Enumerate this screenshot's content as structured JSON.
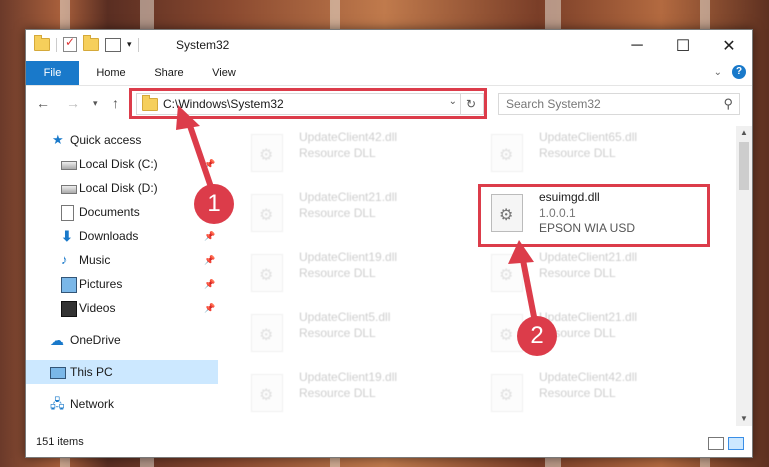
{
  "window": {
    "title": "System32",
    "icons": [
      "folder-icon",
      "properties-icon",
      "new-folder-icon",
      "view-icon"
    ]
  },
  "ribbon": {
    "tabs": [
      "File",
      "Home",
      "Share",
      "View"
    ],
    "help": "?"
  },
  "address": {
    "path": "C:\\Windows\\System32",
    "search_placeholder": "Search System32"
  },
  "nav": {
    "items": [
      {
        "label": "Quick access",
        "icon": "star-icon",
        "pinned": false
      },
      {
        "label": "Local Disk (C:)",
        "icon": "disk-icon",
        "pinned": true
      },
      {
        "label": "Local Disk (D:)",
        "icon": "disk-icon",
        "pinned": true
      },
      {
        "label": "Documents",
        "icon": "documents-icon",
        "pinned": true
      },
      {
        "label": "Downloads",
        "icon": "downloads-icon",
        "pinned": true
      },
      {
        "label": "Music",
        "icon": "music-icon",
        "pinned": true
      },
      {
        "label": "Pictures",
        "icon": "pictures-icon",
        "pinned": true
      },
      {
        "label": "Videos",
        "icon": "videos-icon",
        "pinned": true
      },
      {
        "label": "OneDrive",
        "icon": "cloud-icon",
        "pinned": false
      },
      {
        "label": "This PC",
        "icon": "pc-icon",
        "pinned": false,
        "selected": true
      },
      {
        "label": "Network",
        "icon": "network-icon",
        "pinned": false
      }
    ]
  },
  "files": {
    "col1": [
      {
        "name": "UpdateClient42.dll",
        "type": "Resource DLL"
      },
      {
        "name": "UpdateClient21.dll",
        "type": "Resource DLL"
      },
      {
        "name": "UpdateClient19.dll",
        "type": "Resource DLL"
      },
      {
        "name": "UpdateClient5.dll",
        "type": "Resource DLL"
      },
      {
        "name": "UpdateClient19.dll",
        "type": "Resource DLL"
      }
    ],
    "col2": [
      {
        "name": "UpdateClient65.dll",
        "type": "Resource DLL"
      },
      {
        "name": "esuimgd.dll",
        "version": "1.0.0.1",
        "type": "EPSON WIA USD",
        "highlighted": true
      },
      {
        "name": "UpdateClient21.dll",
        "type": "Resource DLL"
      },
      {
        "name": "UpdateClient21.dll",
        "type": "Resource DLL"
      },
      {
        "name": "UpdateClient42.dll",
        "type": "Resource DLL"
      }
    ]
  },
  "status": {
    "item_count": "151 items"
  },
  "annotations": {
    "badge1": "1",
    "badge2": "2",
    "color": "#dc3c4a"
  }
}
